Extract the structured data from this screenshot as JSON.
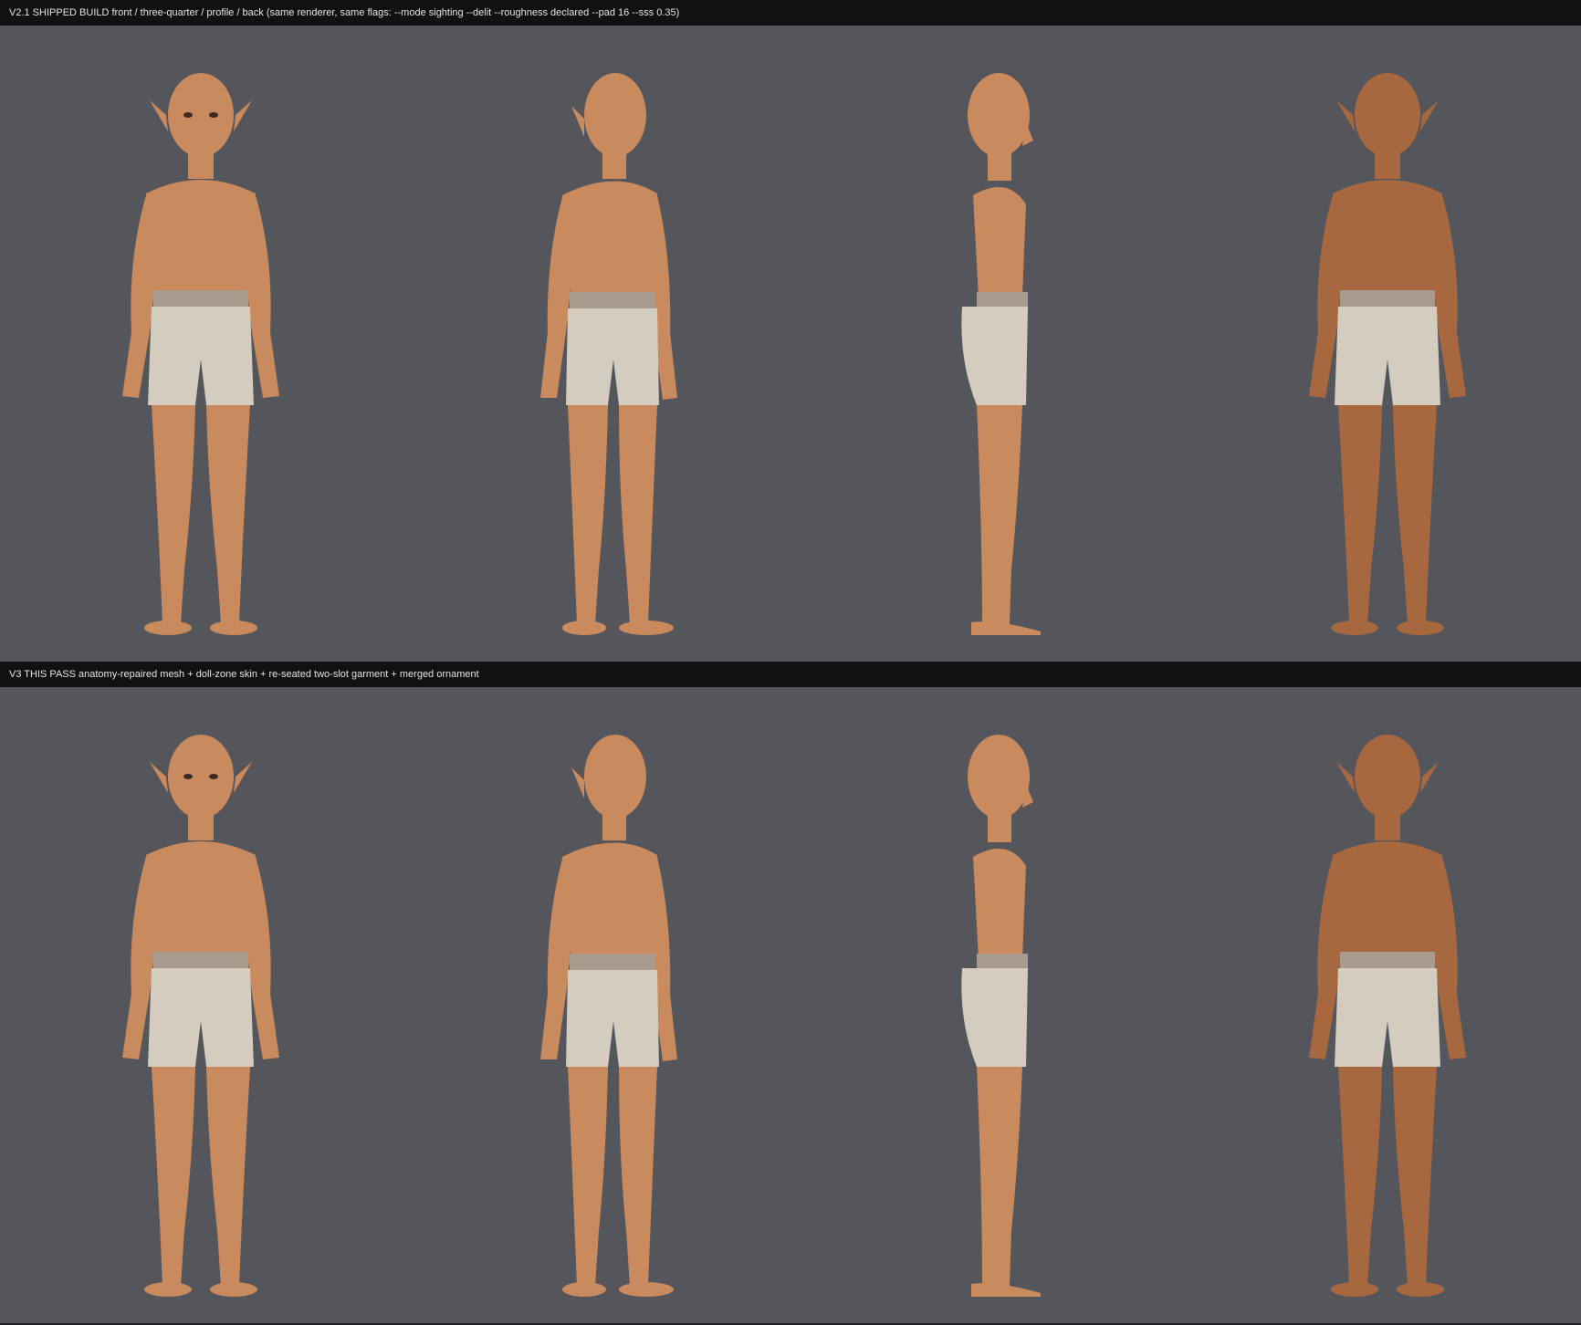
{
  "rows": [
    {
      "caption": "V2.1 SHIPPED BUILD  front / three-quarter / profile / back   (same renderer, same flags: --mode sighting --delit --roughness declared --pad 16 --sss 0.35)",
      "views": [
        "front",
        "three-quarter",
        "profile",
        "back"
      ]
    },
    {
      "caption": "V3 THIS PASS  anatomy-repaired mesh + doll-zone skin + re-seated two-slot garment + merged ornament",
      "views": [
        "front",
        "three-quarter",
        "profile",
        "back"
      ]
    }
  ],
  "colors": {
    "background": "#55555c",
    "bar": "#111113",
    "skin_front": "#c98a5d",
    "skin_back": "#a8683f",
    "garment": "#d4ccbf",
    "waistband": "#a89a8c"
  }
}
